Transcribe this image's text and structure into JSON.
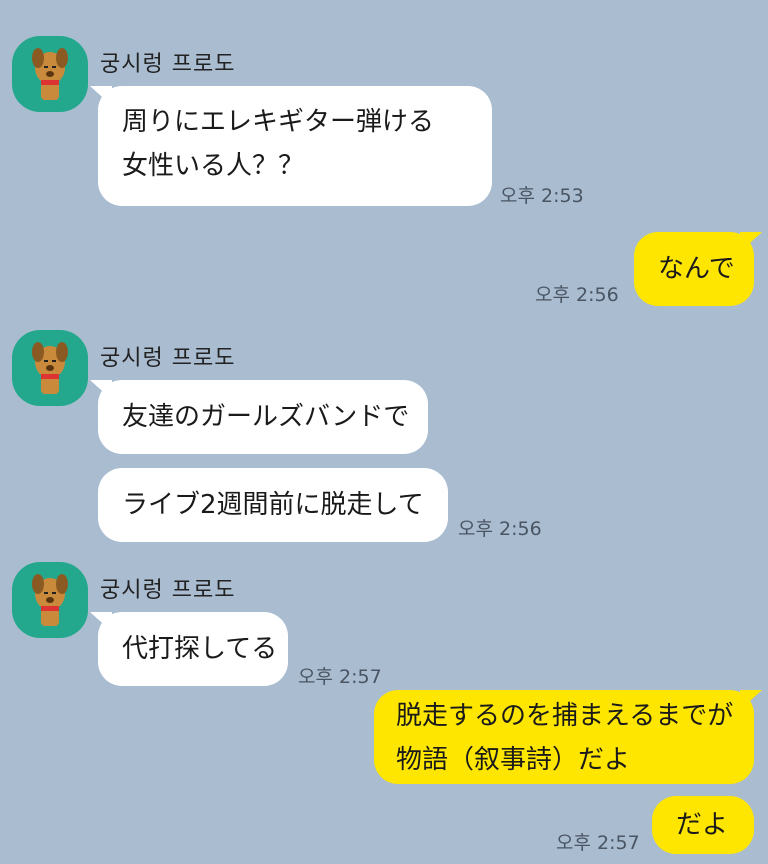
{
  "messages": [
    {
      "sender": "궁시렁 프로도",
      "lines": [
        "周りにエレキギター弾ける",
        "女性いる人？？"
      ],
      "time": "오후 2:53"
    },
    {
      "lines": [
        "なんで"
      ],
      "time": "오후 2:56"
    },
    {
      "sender": "궁시렁 프로도",
      "line1": "友達のガールズバンドで",
      "line2": "ライブ2週間前に脱走して",
      "time": "오후 2:56"
    },
    {
      "sender": "궁시렁 프로도",
      "lines": [
        "代打探してる"
      ],
      "time": "오후 2:57"
    },
    {
      "lines": [
        "脱走するのを捕まえるまでが",
        "物語（叙事詩）だよ"
      ]
    },
    {
      "lines": [
        "だよ"
      ],
      "time": "오후 2:57"
    }
  ],
  "colors": {
    "background": "#a9bcd0",
    "incoming_bubble": "#ffffff",
    "outgoing_bubble": "#fee600",
    "avatar_bg": "#23a88e"
  },
  "icons": {
    "avatar": "dog-character-avatar-icon"
  }
}
